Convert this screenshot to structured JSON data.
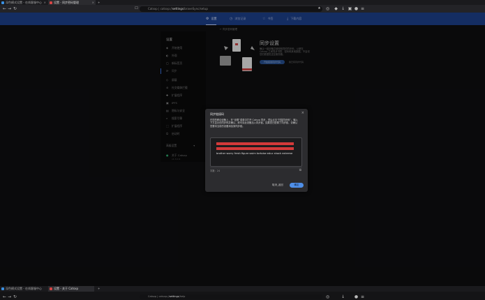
{
  "browser": {
    "tabs": [
      {
        "label": "深色模式设置 - 在线客服中心",
        "active": false
      },
      {
        "label": "设置 - 同步密码管理",
        "active": true
      }
    ],
    "new_tab": "+",
    "url_prefix": "Catsxp | catsxp://",
    "url_main": "settings",
    "url_suffix": "/braveSync/setup"
  },
  "navtabs": [
    {
      "label": "设置",
      "icon": "gear-icon",
      "active": true
    },
    {
      "label": "浏览记录",
      "icon": "history-icon",
      "active": false
    },
    {
      "label": "书签",
      "icon": "bookmark-icon",
      "active": false
    },
    {
      "label": "下载内容",
      "icon": "download-icon",
      "active": false
    }
  ],
  "menu": {
    "title": "设置",
    "items": [
      {
        "label": "开始使用",
        "icon": "rocket-icon"
      },
      {
        "label": "外观",
        "icon": "palette-icon"
      },
      {
        "label": "新标签页",
        "icon": "newtab-icon"
      },
      {
        "label": "同步",
        "icon": "sync-icon",
        "selected": true
      },
      {
        "label": "屏蔽",
        "icon": "shield-icon"
      },
      {
        "label": "社交媒体拦截",
        "icon": "block-icon"
      },
      {
        "label": "扩展程序",
        "icon": "puzzle-icon"
      },
      {
        "label": "IPFS",
        "icon": "cube-icon"
      },
      {
        "label": "隐私与安全",
        "icon": "lock-icon"
      },
      {
        "label": "搜索引擎",
        "icon": "search-icon"
      },
      {
        "label": "扩展程序",
        "icon": "extension-icon"
      },
      {
        "label": "启动时",
        "icon": "power-icon"
      }
    ],
    "advanced": "高级设置",
    "about_title": "关于 Catsxp",
    "about_sub": "v1.3.0.9"
  },
  "content": {
    "breadcrumb": "← 同步密码管理",
    "title": "同步设置",
    "desc": "确认一组设备并使用相同的同步码，以便在 Catsxp 之间同步书签、密码和其他数据。不会将您的数据发送至服务器。",
    "primary_button": "开始使用同步代码",
    "secondary_link": "我已有同步代码"
  },
  "dialog": {
    "title": "同步链接码",
    "description": "在您的移动设备上，在“设置”菜单中打开 Catsxp 同步，然后点击“扫描同步码”。输入下方显示的同步码并确认，即可将此设备加入同步链。如果您已配置了同步链，请确认您要将当前的设备添加到同步链。",
    "phrase": "brother worry fresh figure swim tortoise educ shock extreme",
    "word_count_label": "字数：24",
    "cancel": "取消_返回",
    "ok": "确定"
  },
  "bottom": {
    "tabs": [
      {
        "label": "深色模式设置 - 在线客服中心",
        "active": false
      },
      {
        "label": "设置 - 关于 Catsxp",
        "active": true
      }
    ],
    "url_prefix": "Catsxp | catsxp://",
    "url_main": "settings",
    "url_suffix": "/help"
  },
  "colors": {
    "nav_blue": "#1d3f88",
    "accent": "#4f8fe8",
    "danger": "#d33a3a"
  }
}
